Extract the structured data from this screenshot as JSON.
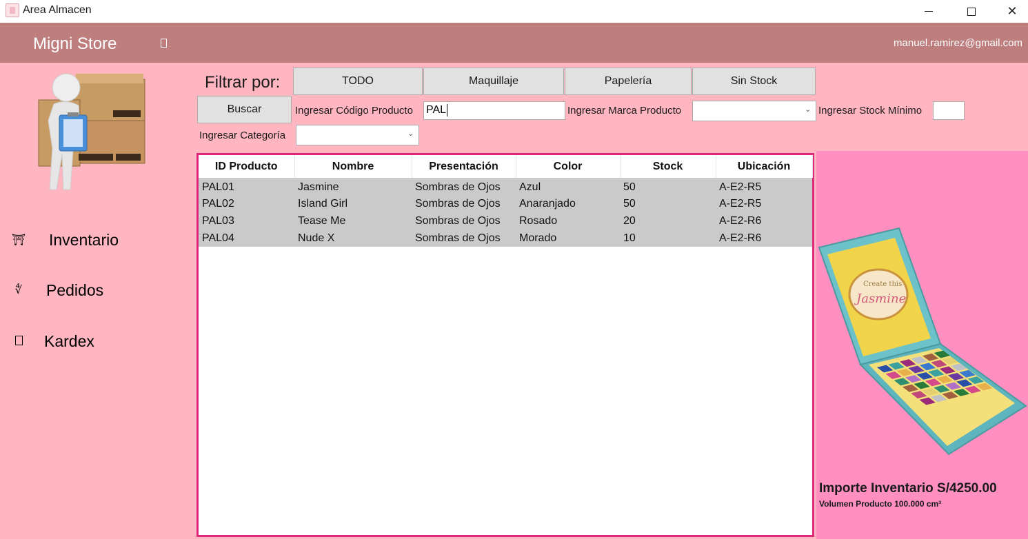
{
  "window": {
    "title": "Area Almacen",
    "icons": {
      "minimize": "minimize-icon",
      "maximize": "maximize-icon",
      "close": "close-icon"
    },
    "close_glyph": "✕"
  },
  "header": {
    "brand": "Migni Store",
    "user_email": "manuel.ramirez@gmail.com",
    "menu_icon": "menu-icon"
  },
  "sidebar": {
    "items": [
      {
        "label": "Inventario",
        "icon": "inventory-icon",
        "glyph": "⛩"
      },
      {
        "label": "Pedidos",
        "icon": "orders-icon",
        "glyph": "∜"
      },
      {
        "label": "Kardex",
        "icon": "kardex-icon",
        "glyph": ""
      }
    ]
  },
  "filters": {
    "title": "Filtrar por:",
    "buttons": [
      "TODO",
      "Maquillaje",
      "Papelería",
      "Sin Stock"
    ],
    "search_button": "Buscar",
    "codigo_label": "Ingresar Código Producto",
    "codigo_value": "PAL",
    "marca_label": "Ingresar Marca Producto",
    "marca_value": "",
    "stock_label": "Ingresar Stock Mínimo",
    "stock_value": "",
    "categoria_label": "Ingresar Categoría",
    "categoria_value": ""
  },
  "table": {
    "columns": [
      "ID Producto",
      "Nombre",
      "Presentación",
      "Color",
      "Stock",
      "Ubicación"
    ],
    "rows": [
      [
        "PAL01",
        "Jasmine",
        "Sombras de Ojos",
        "Azul",
        "50",
        "A-E2-R5"
      ],
      [
        "PAL02",
        "Island Girl",
        "Sombras de Ojos",
        "Anaranjado",
        "50",
        "A-E2-R5"
      ],
      [
        "PAL03",
        "Tease Me",
        "Sombras de Ojos",
        "Rosado",
        "20",
        "A-E2-R6"
      ],
      [
        "PAL04",
        "Nude X",
        "Sombras de Ojos",
        "Morado",
        "10",
        "A-E2-R6"
      ]
    ]
  },
  "summary": {
    "importe": "Importe Inventario S/4250.00",
    "volumen": "Volumen Producto 100.000 cm³",
    "palette_text": "Jasmine",
    "palette_brand": "Create this"
  },
  "colors": {
    "header": "#bf7e7e",
    "sidebar": "#ffb6c1",
    "right_panel": "#ff8fc1",
    "grid_border": "#e0287a",
    "row_bg": "#cacaca"
  }
}
